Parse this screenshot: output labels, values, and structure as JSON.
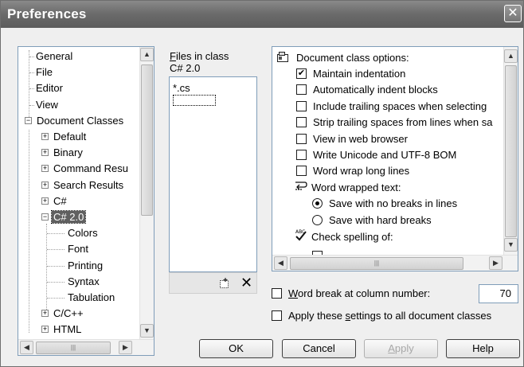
{
  "window": {
    "title": "Preferences",
    "close_glyph": "✕"
  },
  "tree": {
    "items": [
      {
        "label": "General"
      },
      {
        "label": "File"
      },
      {
        "label": "Editor"
      },
      {
        "label": "View"
      },
      {
        "label": "Document Classes",
        "expander": "−"
      },
      {
        "label": "Default",
        "expander": "+"
      },
      {
        "label": "Binary",
        "expander": "+"
      },
      {
        "label": "Command Resu",
        "expander": "+"
      },
      {
        "label": "Search Results",
        "expander": "+"
      },
      {
        "label": "C#",
        "expander": "+"
      },
      {
        "label": "C# 2.0",
        "expander": "−",
        "selected": true
      },
      {
        "label": "Colors"
      },
      {
        "label": "Font"
      },
      {
        "label": "Printing"
      },
      {
        "label": "Syntax"
      },
      {
        "label": "Tabulation"
      },
      {
        "label": "C/C++",
        "expander": "+"
      },
      {
        "label": "HTML",
        "expander": "+"
      }
    ]
  },
  "files_panel": {
    "label_accel": "F",
    "label_rest": "iles in class",
    "label_line2": "C# 2.0",
    "items": [
      "*.cs"
    ],
    "new_icon": "new-file-icon",
    "delete_glyph": "✕"
  },
  "options_panel": {
    "header": "Document class options:",
    "items": [
      {
        "kind": "checkbox",
        "label": "Maintain indentation",
        "checked": true
      },
      {
        "kind": "checkbox",
        "label": "Automatically indent blocks",
        "checked": false
      },
      {
        "kind": "checkbox",
        "label": "Include trailing spaces when selecting",
        "checked": false
      },
      {
        "kind": "checkbox",
        "label": "Strip trailing spaces from lines when sa",
        "checked": false
      },
      {
        "kind": "checkbox",
        "label": "View in web browser",
        "checked": false
      },
      {
        "kind": "checkbox",
        "label": "Write Unicode and UTF-8 BOM",
        "checked": false
      },
      {
        "kind": "checkbox",
        "label": "Word wrap long lines",
        "checked": false
      },
      {
        "kind": "group",
        "label": "Word wrapped text:"
      },
      {
        "kind": "radio",
        "label": "Save with no breaks in lines",
        "checked": true
      },
      {
        "kind": "radio",
        "label": "Save with hard breaks",
        "checked": false
      },
      {
        "kind": "group",
        "label": "Check spelling of:"
      }
    ]
  },
  "word_break": {
    "label_accel": "W",
    "label_rest": "ord break at column number:",
    "checked": false,
    "value": "70"
  },
  "apply_all": {
    "label_before": "Apply these ",
    "label_accel": "s",
    "label_after": "ettings to all document classes",
    "checked": false
  },
  "buttons": {
    "ok": "OK",
    "cancel": "Cancel",
    "apply_accel": "A",
    "apply_rest": "pply",
    "help": "Help"
  },
  "scroll_arrows": {
    "up": "▲",
    "down": "▼",
    "left": "◀",
    "right": "▶",
    "grip": "|||"
  }
}
